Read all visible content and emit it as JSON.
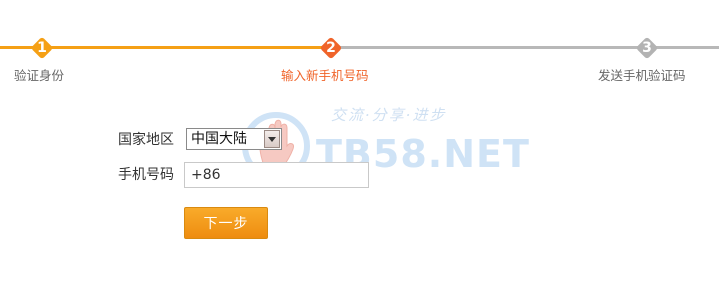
{
  "steps": [
    {
      "number": "1",
      "label": "验证身份",
      "state": "done"
    },
    {
      "number": "2",
      "label": "输入新手机号码",
      "state": "current"
    },
    {
      "number": "3",
      "label": "发送手机验证码",
      "state": "pending"
    }
  ],
  "form": {
    "country_label": "国家地区",
    "country_value": "中国大陆",
    "phone_label": "手机号码",
    "phone_value": "+86",
    "next_button": "下一步"
  },
  "watermark": {
    "tagline": "交流·分享·进步",
    "brand": "TB58.NET"
  },
  "colors": {
    "done": "#f5a015",
    "current": "#f0642a",
    "pending": "#b3b3b3",
    "button": "#f5a015"
  },
  "icons": {
    "country_dropdown": "chevron-down-icon",
    "watermark_logo": "hand-logo-icon"
  }
}
